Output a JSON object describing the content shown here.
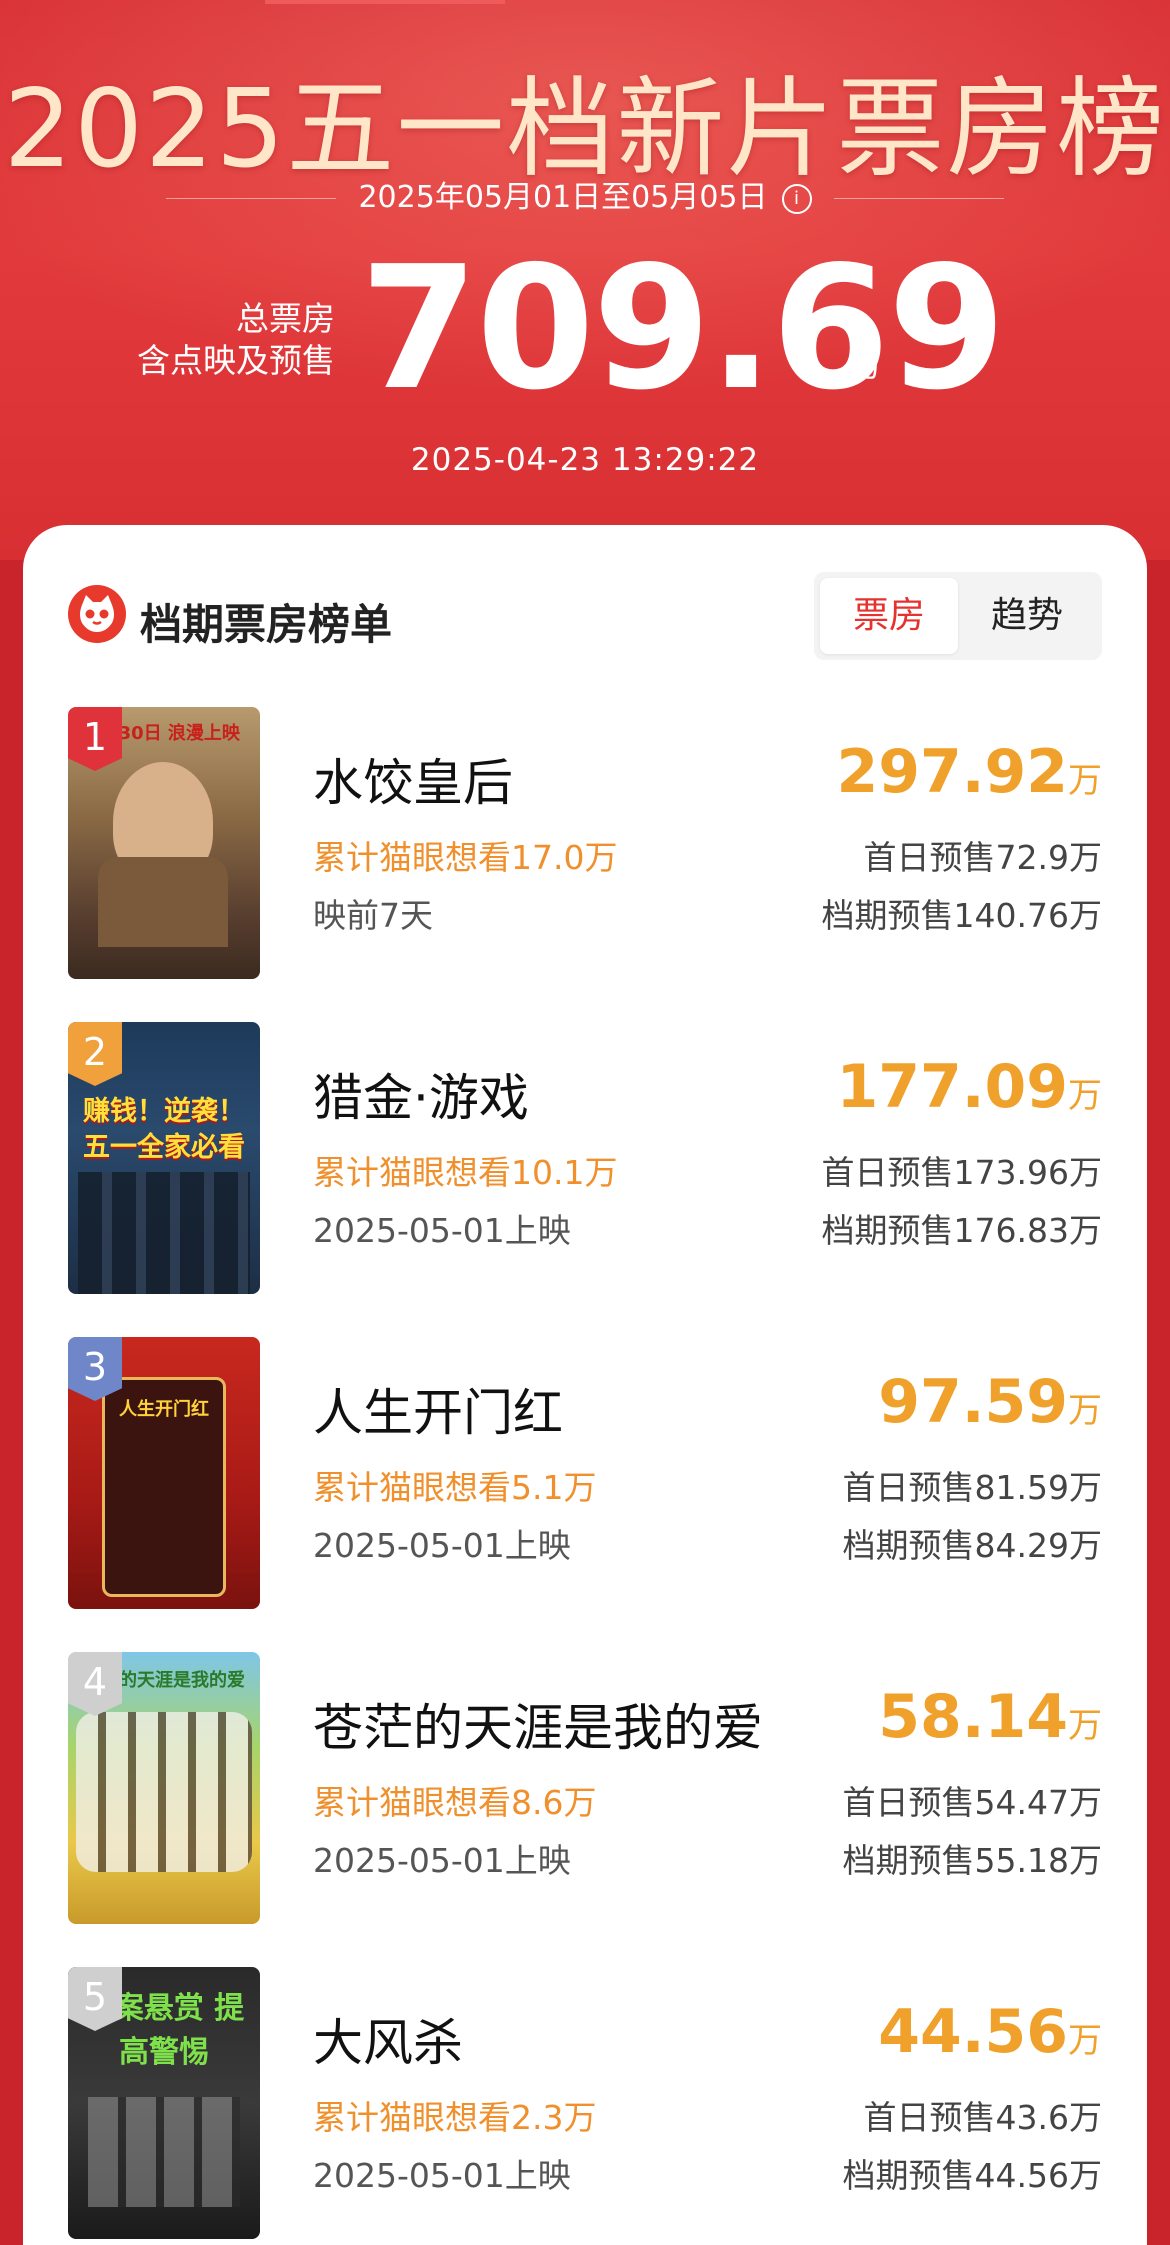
{
  "header": {
    "title": "2025五一档新片票房榜",
    "date_range": "2025年05月01日至05月05日",
    "info_icon": "info-icon",
    "total_label_1": "总票房",
    "total_label_2": "含点映及预售",
    "total_value": "709.69",
    "total_unit": "万",
    "timestamp": "2025-04-23  13:29:22"
  },
  "card": {
    "title": "档期票房榜单",
    "logo_icon": "maoyan-cat-icon",
    "tabs": [
      {
        "label": "票房",
        "active": true
      },
      {
        "label": "趋势",
        "active": false
      }
    ]
  },
  "movies": [
    {
      "rank": "1",
      "name": "水饺皇后",
      "want": "累计猫眼想看17.0万",
      "release": "映前7天",
      "box": "297.92",
      "unit": "万",
      "first_day": "首日预售72.9万",
      "presale": "档期预售140.76万",
      "poster_text": "4月30日 浪漫上映"
    },
    {
      "rank": "2",
      "name": "猎金·游戏",
      "want": "累计猫眼想看10.1万",
      "release": "2025-05-01上映",
      "box": "177.09",
      "unit": "万",
      "first_day": "首日预售173.96万",
      "presale": "档期预售176.83万",
      "poster_text": "赚钱！逆袭！五一全家必看"
    },
    {
      "rank": "3",
      "name": "人生开门红",
      "want": "累计猫眼想看5.1万",
      "release": "2025-05-01上映",
      "box": "97.59",
      "unit": "万",
      "first_day": "首日预售81.59万",
      "presale": "档期预售84.29万",
      "poster_text": "人生开门红"
    },
    {
      "rank": "4",
      "name": "苍茫的天涯是我的爱",
      "want": "累计猫眼想看8.6万",
      "release": "2025-05-01上映",
      "box": "58.14",
      "unit": "万",
      "first_day": "首日预售54.47万",
      "presale": "档期预售55.18万",
      "poster_text": "苍茫的天涯是我的爱"
    },
    {
      "rank": "5",
      "name": "大风杀",
      "want": "累计猫眼想看2.3万",
      "release": "2025-05-01上映",
      "box": "44.56",
      "unit": "万",
      "first_day": "首日预售43.6万",
      "presale": "档期预售44.56万",
      "poster_text": "悬案悬赏 提高警惕"
    }
  ],
  "colors": {
    "brand_red": "#e23a3c",
    "box_orange": "#f0a12c",
    "want_orange": "#f0902c",
    "rank_1": "#e0323a",
    "rank_2": "#f0a13c",
    "rank_3": "#6f86c9",
    "rank_4": "#cfcfcf",
    "rank_5": "#cfcfcf"
  }
}
